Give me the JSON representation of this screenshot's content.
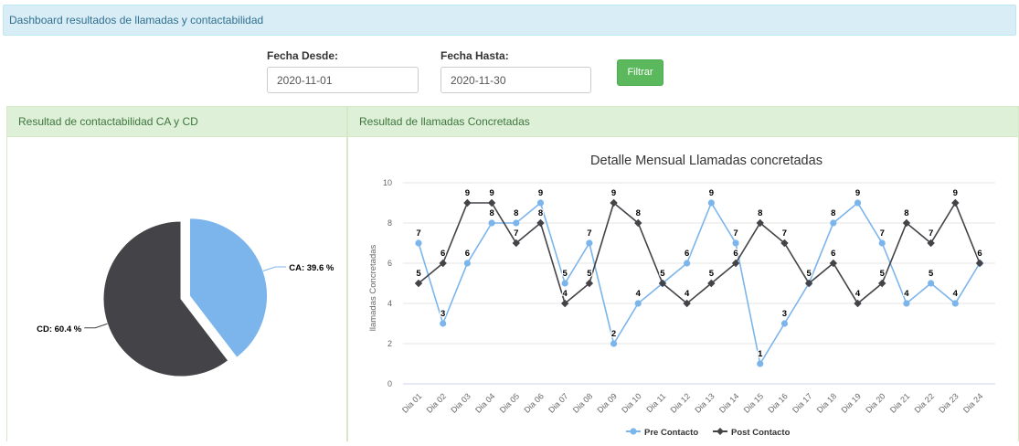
{
  "header": {
    "title": "Dashboard resultados de llamadas y contactabilidad"
  },
  "filters": {
    "desde_label": "Fecha Desde:",
    "desde_value": "2020-11-01",
    "hasta_label": "Fecha Hasta:",
    "hasta_value": "2020-11-30",
    "button_label": "Filtrar",
    "button_color": "#5cb85c"
  },
  "left_panel": {
    "title": "Resultad de contactabilidad CA y CD"
  },
  "right_panel": {
    "title": "Resultad de llamadas Concretadas"
  },
  "chart_data": [
    {
      "type": "pie",
      "slices": [
        {
          "label": "CA: 39.6 %",
          "value": 39.6,
          "color": "#7cb5ec"
        },
        {
          "label": "CD: 60.4 %",
          "value": 60.4,
          "color": "#434348"
        }
      ]
    },
    {
      "type": "line",
      "title": "Detalle Mensual Llamadas concretadas",
      "ylabel": "llamadas Concretadas",
      "ylim": [
        0,
        10
      ],
      "yticks": [
        0,
        2,
        4,
        6,
        8,
        10
      ],
      "grid": true,
      "legend_position": "bottom-center",
      "categories": [
        "Dia 01",
        "Dia 02",
        "Dia 03",
        "Dia 04",
        "Dia 05",
        "Dia 06",
        "Dia 07",
        "Dia 08",
        "Dia 09",
        "Dia 10",
        "Dia 11",
        "Dia 12",
        "Dia 13",
        "Dia 14",
        "Dia 15",
        "Dia 16",
        "Dia 17",
        "Dia 18",
        "Dia 19",
        "Dia 20",
        "Dia 21",
        "Dia 22",
        "Dia 23",
        "Dia 24"
      ],
      "series": [
        {
          "name": "Pre Contacto",
          "color": "#7cb5ec",
          "marker": "circle",
          "values": [
            7,
            3,
            6,
            8,
            8,
            9,
            5,
            7,
            2,
            4,
            5,
            6,
            9,
            7,
            1,
            3,
            5,
            8,
            9,
            7,
            4,
            5,
            4,
            6
          ]
        },
        {
          "name": "Post Contacto",
          "color": "#434348",
          "marker": "diamond",
          "values": [
            5,
            6,
            9,
            9,
            7,
            8,
            4,
            5,
            9,
            8,
            5,
            4,
            5,
            6,
            8,
            7,
            5,
            6,
            4,
            5,
            8,
            7,
            9,
            6
          ]
        }
      ]
    }
  ]
}
